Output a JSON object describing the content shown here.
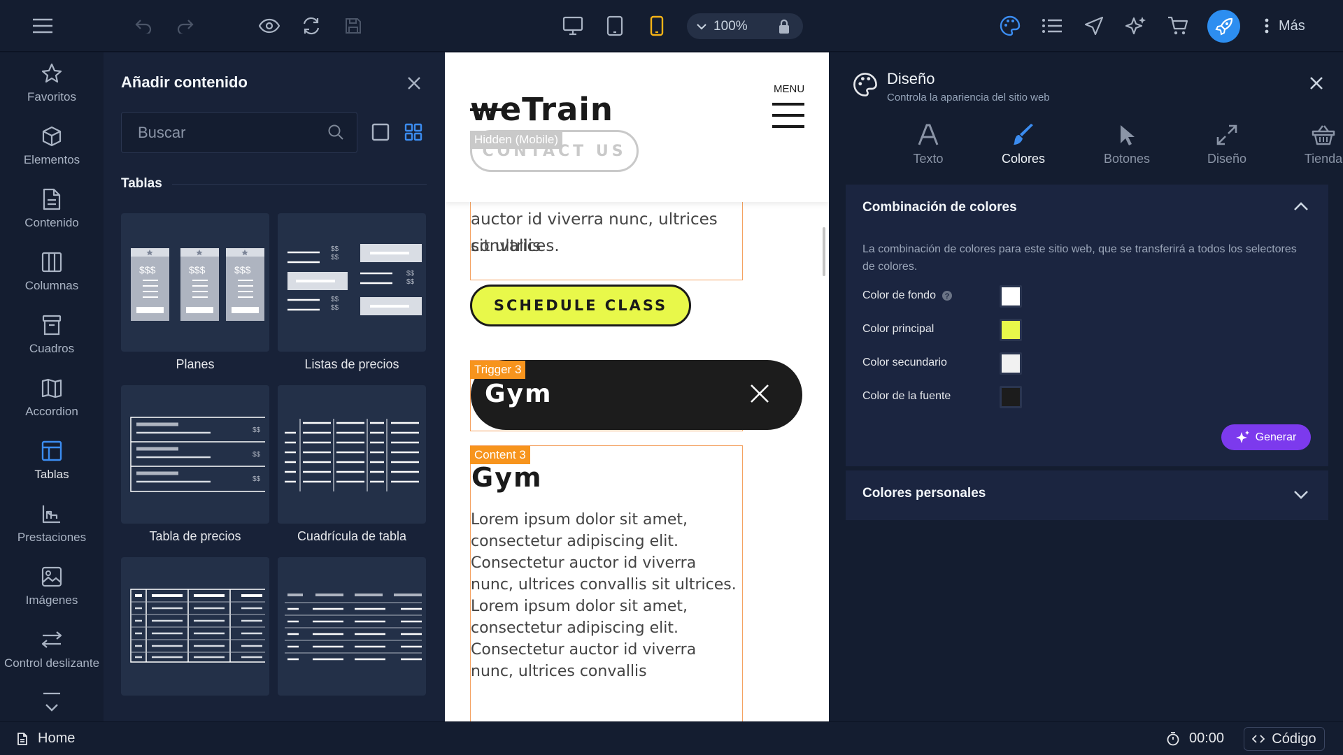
{
  "topbar": {
    "zoom": "100%",
    "more_label": "Más"
  },
  "leftnav": {
    "items": [
      {
        "label": "Favoritos",
        "icon": "star-icon"
      },
      {
        "label": "Elementos",
        "icon": "cube-icon"
      },
      {
        "label": "Contenido",
        "icon": "document-icon"
      },
      {
        "label": "Columnas",
        "icon": "columns-icon"
      },
      {
        "label": "Cuadros",
        "icon": "box-icon"
      },
      {
        "label": "Accordion",
        "icon": "accordion-icon"
      },
      {
        "label": "Tablas",
        "icon": "table-icon",
        "active": true
      },
      {
        "label": "Prestaciones",
        "icon": "features-icon"
      },
      {
        "label": "Imágenes",
        "icon": "image-icon"
      },
      {
        "label": "Control deslizante",
        "icon": "slider-icon"
      }
    ]
  },
  "addpanel": {
    "title": "Añadir contenido",
    "search_placeholder": "Buscar",
    "section": "Tablas",
    "cards": [
      {
        "label": "Planes"
      },
      {
        "label": "Listas de precios"
      },
      {
        "label": "Tabla de precios"
      },
      {
        "label": "Cuadrícula de tabla"
      }
    ]
  },
  "preview": {
    "logo": "weTrain",
    "menu_label": "MENU",
    "contact_btn": "CONTACT US",
    "hidden_tag": "Hidden (Mobile)",
    "partial_text_line1": "auctor id viverra nunc, ultrices convallis",
    "partial_text_line2": "sit ultrices.",
    "schedule_btn": "SCHEDULE CLASS",
    "trigger_tag": "Trigger 3",
    "trigger_title": "Gym",
    "content_tag": "Content 3",
    "content_title": "Gym",
    "content_body": "Lorem ipsum dolor sit amet, consectetur adipiscing elit. Consectetur auctor id viverra nunc, ultrices convallis sit ultrices. Lorem ipsum dolor sit amet, consectetur adipiscing elit. Consectetur auctor id viverra nunc, ultrices convallis"
  },
  "design": {
    "title": "Diseño",
    "subtitle": "Controla la apariencia del sitio web",
    "tabs": [
      {
        "label": "Texto",
        "icon": "text-icon"
      },
      {
        "label": "Colores",
        "icon": "brush-icon",
        "active": true
      },
      {
        "label": "Botones",
        "icon": "cursor-icon"
      },
      {
        "label": "Diseño",
        "icon": "expand-icon"
      },
      {
        "label": "Tienda",
        "icon": "basket-icon"
      }
    ],
    "scheme": {
      "title": "Combinación de colores",
      "desc": "La combinación de colores para este sitio web, que se transferirá a todos los selectores de colores.",
      "rows": [
        {
          "label": "Color de fondo",
          "color": "#ffffff"
        },
        {
          "label": "Color principal",
          "color": "#e8f84a"
        },
        {
          "label": "Color secundario",
          "color": "#f1f1f1"
        },
        {
          "label": "Color de la fuente",
          "color": "#1c1c1c"
        }
      ],
      "generate_label": "Generar"
    },
    "personal": {
      "title": "Colores personales"
    }
  },
  "footer": {
    "page": "Home",
    "timer": "00:00",
    "code_label": "Código"
  }
}
